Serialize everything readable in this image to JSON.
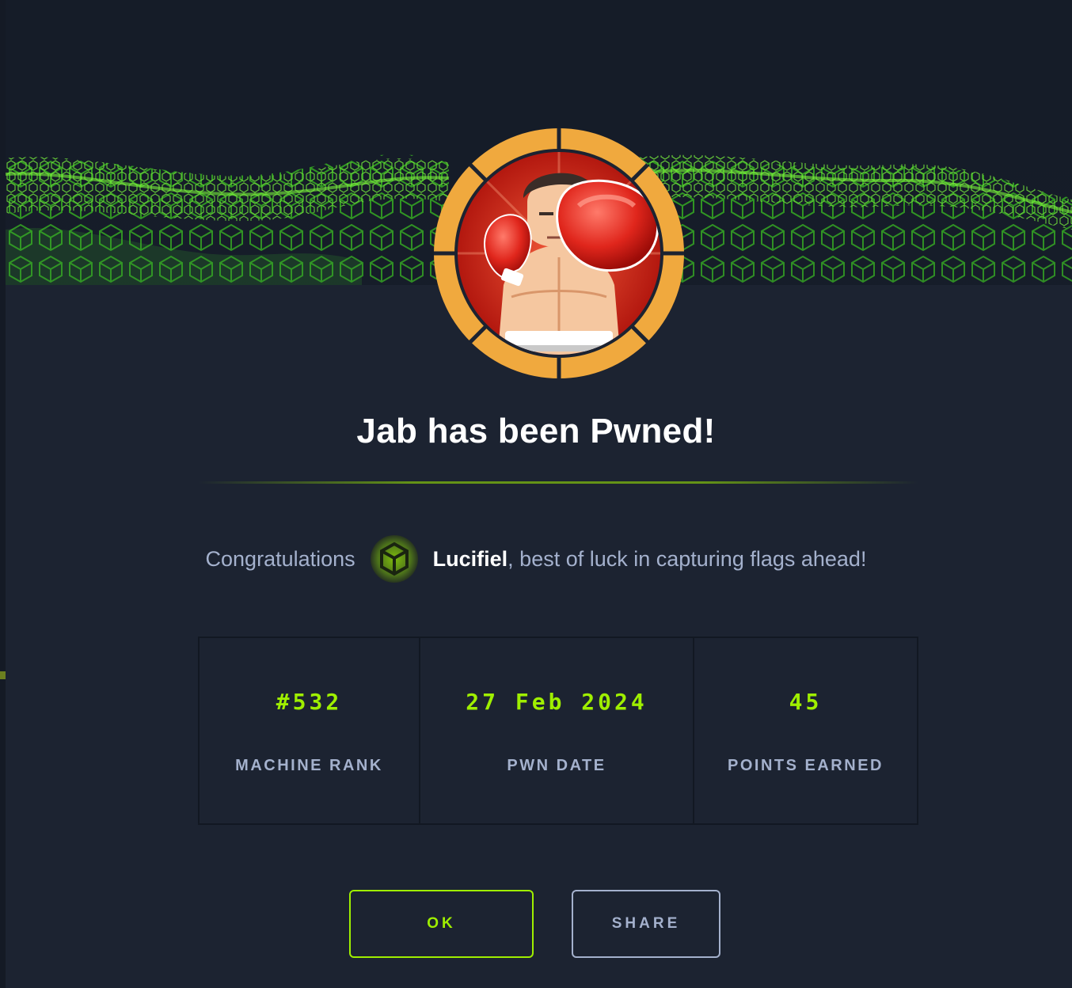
{
  "modal": {
    "title": "Jab has been Pwned!",
    "congrats_prefix": "Congratulations",
    "username": "Lucifiel",
    "congrats_suffix": ", best of luck in capturing flags ahead!"
  },
  "stats": [
    {
      "value": "#532",
      "label": "MACHINE RANK"
    },
    {
      "value": "27 Feb 2024",
      "label": "PWN DATE"
    },
    {
      "value": "45",
      "label": "POINTS EARNED"
    }
  ],
  "buttons": {
    "ok_label": "OK",
    "share_label": "SHARE"
  },
  "icons": {
    "machine_avatar": "boxer-machine-avatar",
    "user_avatar": "green-cube-avatar",
    "banner": "green-cube-wave-banner"
  },
  "colors": {
    "accent": "#9fef00",
    "background": "#1c2331",
    "text_muted": "#a4b1cd",
    "avatar_ring": "#f0a93e"
  }
}
